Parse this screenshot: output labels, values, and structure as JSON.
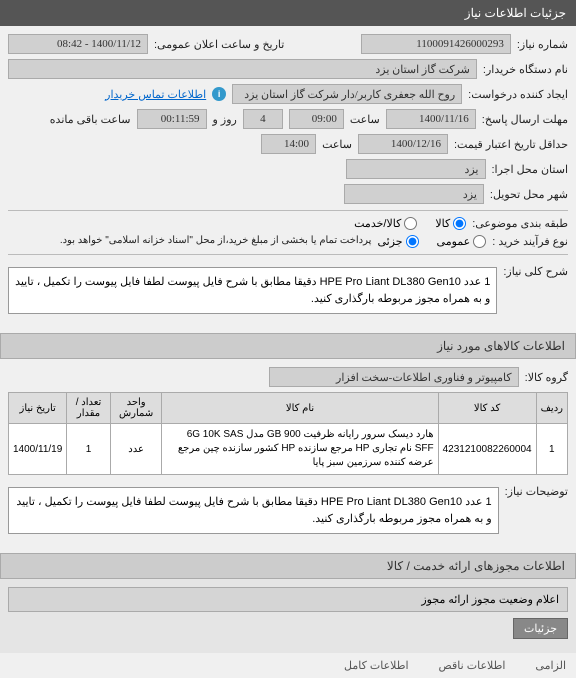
{
  "header": {
    "title": "جزئیات اطلاعات نیاز"
  },
  "fields": {
    "need_no_label": "شماره نیاز:",
    "need_no": "1100091426000293",
    "announce_label": "تاریخ و ساعت اعلان عمومی:",
    "announce": "1400/11/12 - 08:42",
    "buyer_label": "نام دستگاه خریدار:",
    "buyer": "شرکت گاز استان یزد",
    "creator_label": "ایجاد کننده درخواست:",
    "creator": "روح الله جعفری کاربر/دار شرکت گاز استان یزد",
    "contact_link": "اطلاعات تماس خریدار",
    "deadline_label": "مهلت ارسال پاسخ:",
    "deadline_date": "1400/11/16",
    "time_label": "ساعت",
    "deadline_time": "09:00",
    "days_label": "روز و",
    "days": "4",
    "remain_label": "ساعت باقی مانده",
    "remain": "00:11:59",
    "validity_label": "حداقل تاریخ اعتبار قیمت:",
    "validity_date": "1400/12/16",
    "validity_time": "14:00",
    "loc_exec_label": "استان محل اجرا:",
    "loc_exec": "یزد",
    "loc_deliver_label": "شهر محل تحویل:",
    "loc_deliver": "یزد",
    "class_label": "طبقه بندی موضوعی:",
    "class_opt1": "کالا",
    "class_opt2": "کالا/خدمت",
    "process_label": "نوع فرآیند خرید :",
    "process_opt1": "عمومی",
    "process_opt2": "جزئی",
    "process_note": "پرداخت تمام یا بخشی از مبلغ خرید،از محل \"اسناد خزانه اسلامی\" خواهد بود.",
    "summary_label": "شرح کلی نیاز:",
    "summary_text": "1 عدد HPE Pro Liant DL380 Gen10 دقیقا مطابق با شرح فایل پیوست لطفا فایل پیوست را تکمیل ، تایید و به همراه مجوز مربوطه بارگذاری کنید.",
    "group_label": "گروه کالا:",
    "group_value": "کامپیوتر و فناوری اطلاعات-سخت افزار",
    "desc_label": "توضیحات نیاز:",
    "desc_text": "1 عدد HPE Pro Liant DL380 Gen10 دقیقا مطابق با شرح فایل پیوست لطفا فایل پیوست را تکمیل ، تایید و به همراه مجوز مربوطه بارگذاری کنید."
  },
  "section_items": "اطلاعات کالاهای مورد نیاز",
  "table": {
    "headers": {
      "row": "ردیف",
      "code": "کد کالا",
      "name": "نام کالا",
      "unit": "واحد شمارش",
      "qty": "تعداد / مقدار",
      "date": "تاریخ نیاز"
    },
    "rows": [
      {
        "row": "1",
        "code": "4231210082260004",
        "name": "هارد دیسک سرور رایانه ظرفیت GB 900 مدل 6G 10K SAS SFF نام تجاری HP مرجع سازنده HP کشور سازنده چین مرجع عرضه کننده سرزمین سبز پایا",
        "unit": "عدد",
        "qty": "1",
        "date": "1400/11/19"
      }
    ]
  },
  "section_permits": "اطلاعات مجوزهای ارائه خدمت / کالا",
  "section_status": "اعلام وضعیت مجوز ارائه مجوز",
  "details_btn": "جزئیات",
  "legend": {
    "l1": "الزامی",
    "l2": "اطلاعات ناقص",
    "l3": "اطلاعات کامل"
  }
}
